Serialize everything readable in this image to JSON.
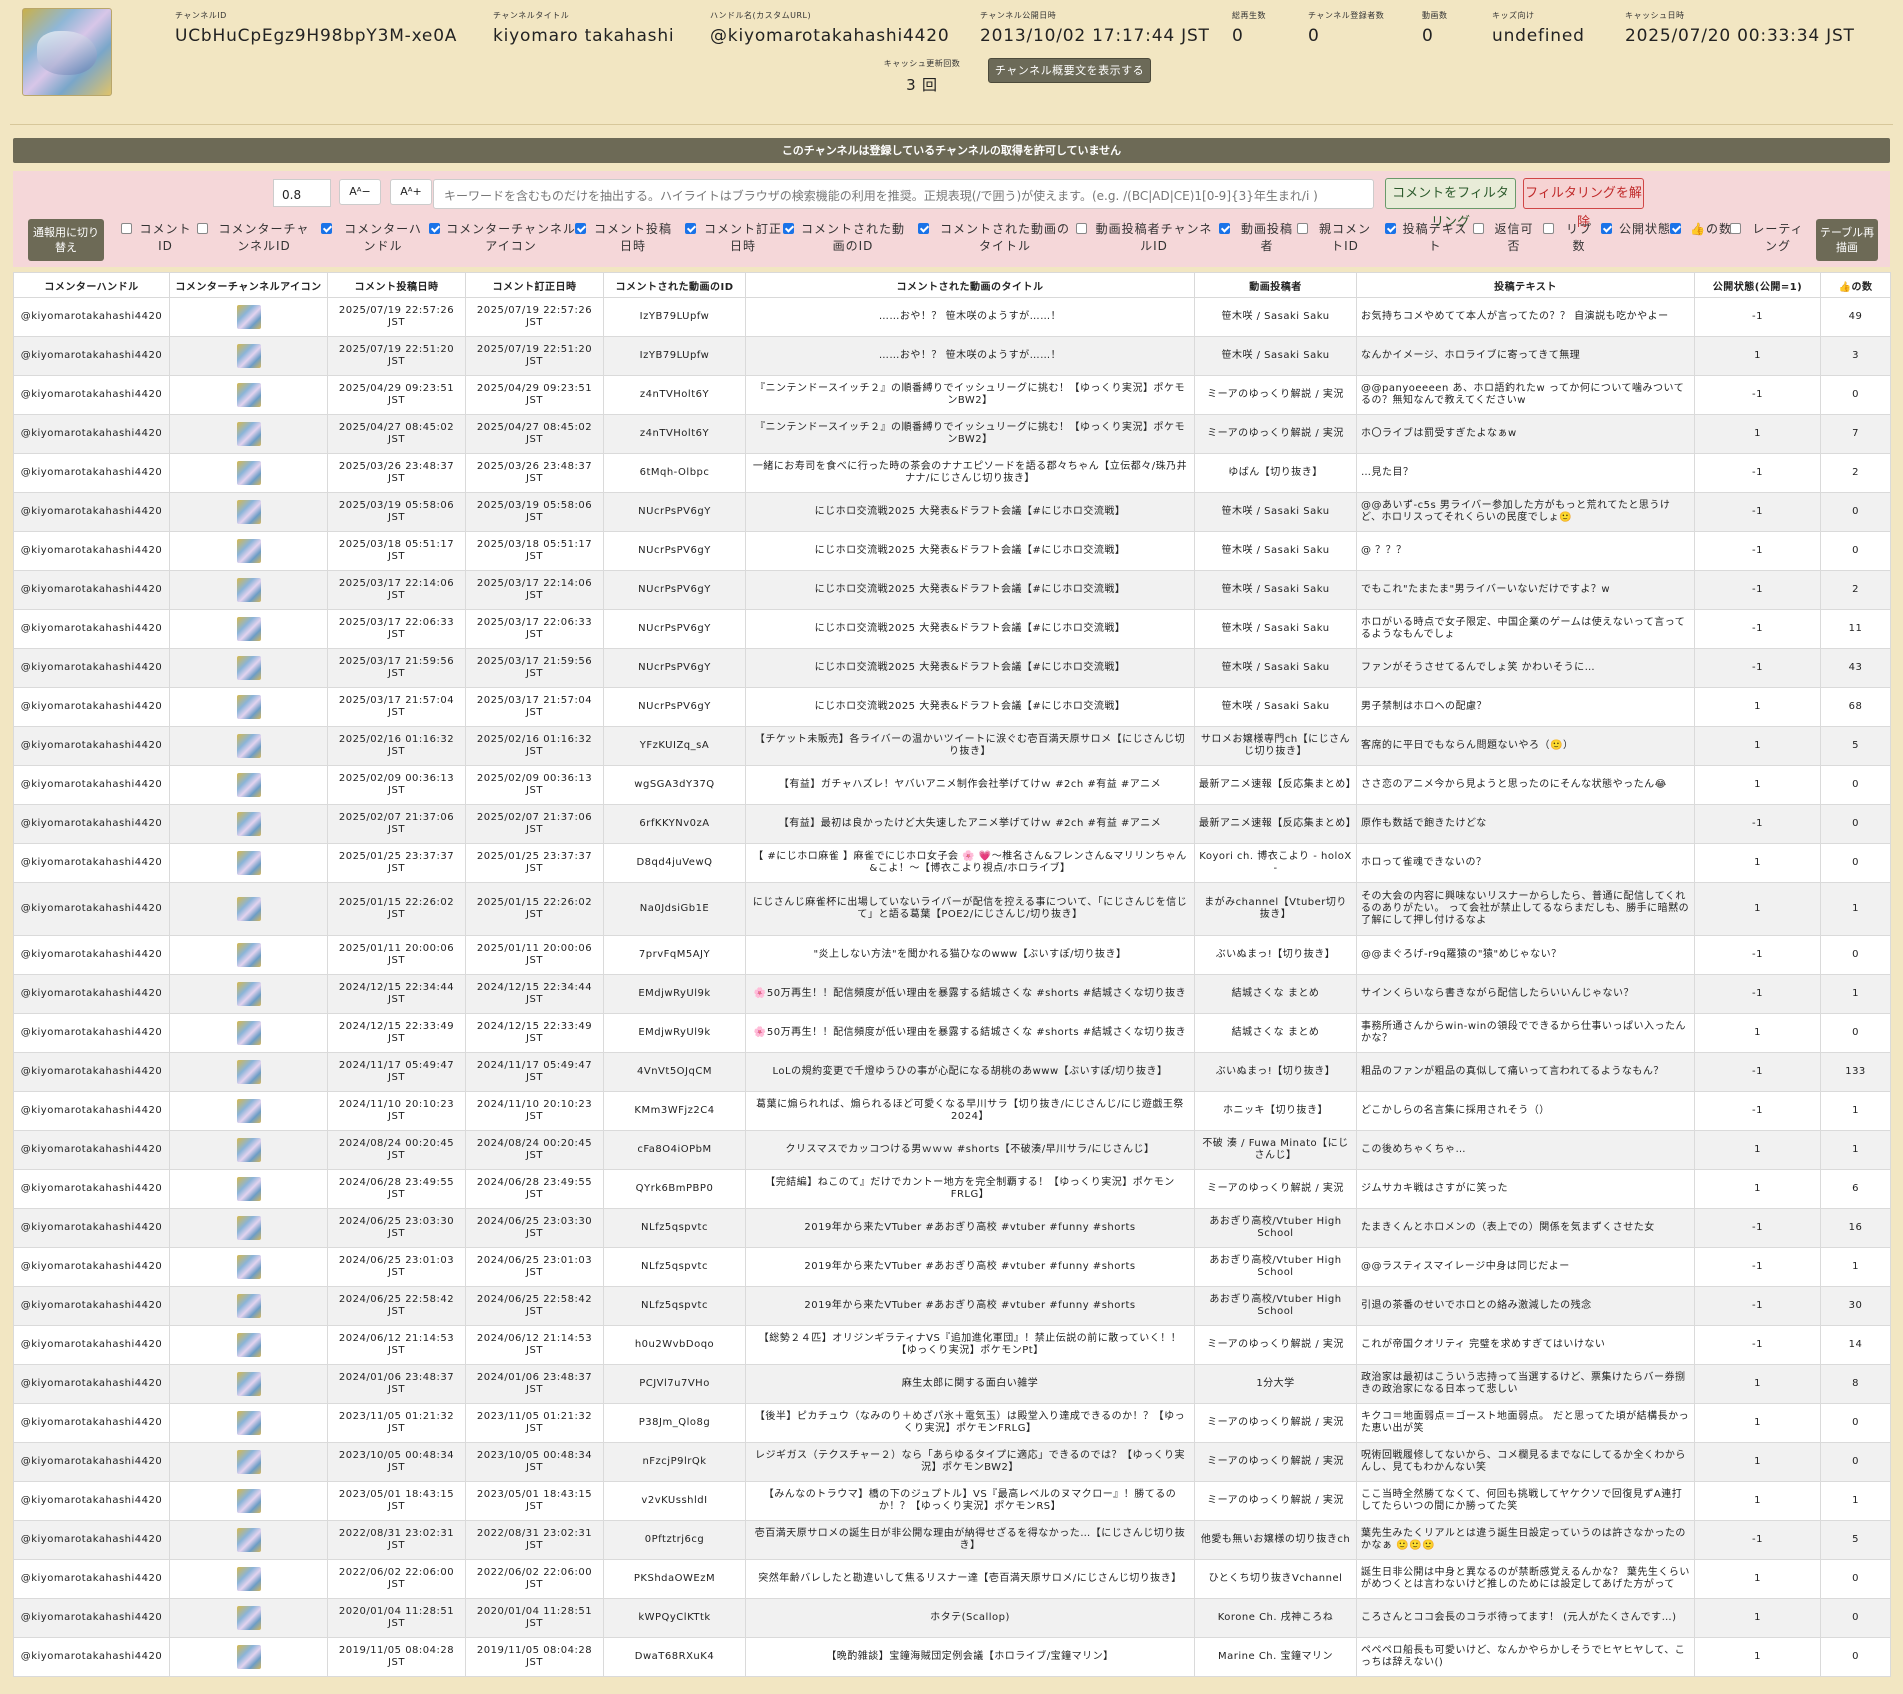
{
  "header": {
    "fields": [
      {
        "label": "チャンネルID",
        "value": "UCbHuCpEgz9H98bpY3M-xe0A"
      },
      {
        "label": "チャンネルタイトル",
        "value": "kiyomaro takahashi"
      },
      {
        "label": "ハンドル名(カスタムURL)",
        "value": "@kiyomarotakahashi4420"
      },
      {
        "label": "チャンネル公開日時",
        "value": "2013/10/02 17:17:44 JST"
      },
      {
        "label": "総再生数",
        "value": "0"
      },
      {
        "label": "チャンネル登録者数",
        "value": "0"
      },
      {
        "label": "動画数",
        "value": "0"
      },
      {
        "label": "キッズ向け",
        "value": "undefined"
      },
      {
        "label": "キャッシュ日時",
        "value": "2025/07/20 00:33:34 JST"
      }
    ],
    "cache_count": {
      "label": "キャッシュ更新回数",
      "value": "3 回"
    },
    "show_description_button": "チャンネル概要文を表示する"
  },
  "notice": "このチャンネルは登録しているチャンネルの取得を許可していません",
  "filter": {
    "zoom_value": "0.8",
    "font_smaller": "Aᴬ−",
    "font_larger": "Aᴬ+",
    "keyword_placeholder": "キーワードを含むものだけを抽出する。ハイライトはブラウザの検索機能の利用を推奨。正規表現(/で囲う)が使えます。(e.g. /(BC|AD|CE)1[0-9]{3}年生まれ/i )",
    "apply_button": "コメントをフィルタリング",
    "clear_button": "フィルタリングを解除",
    "toggle_button": "通報用に切り替え",
    "redraw_button": "テーブル再描画",
    "columns": [
      {
        "label": "コメントID",
        "checked": false
      },
      {
        "label": "コメンターチャンネルID",
        "checked": false
      },
      {
        "label": "コメンターハンドル",
        "checked": true
      },
      {
        "label": "コメンターチャンネルアイコン",
        "checked": true
      },
      {
        "label": "コメント投稿日時",
        "checked": true
      },
      {
        "label": "コメント訂正日時",
        "checked": true
      },
      {
        "label": "コメントされた動画のID",
        "checked": true
      },
      {
        "label": "コメントされた動画のタイトル",
        "checked": true
      },
      {
        "label": "動画投稿者チャンネルID",
        "checked": false
      },
      {
        "label": "動画投稿者",
        "checked": true
      },
      {
        "label": "親コメントID",
        "checked": false
      },
      {
        "label": "投稿テキスト",
        "checked": true
      },
      {
        "label": "返信可否",
        "checked": false
      },
      {
        "label": "リプ数",
        "checked": false
      },
      {
        "label": "公開状態",
        "checked": true
      },
      {
        "label": "👍の数",
        "checked": true
      },
      {
        "label": "レーティング",
        "checked": false
      }
    ]
  },
  "table": {
    "headers": [
      "コメンターハンドル",
      "コメンターチャンネルアイコン",
      "コメント投稿日時",
      "コメント訂正日時",
      "コメントされた動画のID",
      "コメントされた動画のタイトル",
      "動画投稿者",
      "投稿テキスト",
      "公開状態(公開=1)",
      "👍の数"
    ],
    "rows": [
      {
        "handle": "@kiyomarotakahashi4420",
        "posted": "2025/07/19 22:57:26 JST",
        "edited": "2025/07/19 22:57:26 JST",
        "vid": "IzYB79LUpfw",
        "title": "……おや！？ 笹木咲のようすが……！",
        "uploader": "笹木咲 / Sasaki Saku",
        "text": "お気持ちコメやめてて本人が言ってたの？？ 自演説も吃かやよー",
        "public": "-1",
        "likes": "49"
      },
      {
        "handle": "@kiyomarotakahashi4420",
        "posted": "2025/07/19 22:51:20 JST",
        "edited": "2025/07/19 22:51:20 JST",
        "vid": "IzYB79LUpfw",
        "title": "……おや！？ 笹木咲のようすが……！",
        "uploader": "笹木咲 / Sasaki Saku",
        "text": "なんかイメージ、ホロライブに寄ってきて無理",
        "public": "1",
        "likes": "3"
      },
      {
        "handle": "@kiyomarotakahashi4420",
        "posted": "2025/04/29 09:23:51 JST",
        "edited": "2025/04/29 09:23:51 JST",
        "vid": "z4nTVHolt6Y",
        "title": "『ニンテンドースイッチ２』の順番縛りでイッシュリーグに挑む！【ゆっくり実況】ポケモンBW2】",
        "uploader": "ミーアのゆっくり解説 / 実況",
        "text": "@@panyoeeeen あ、ホロ語釣れたw ってか何について噛みついてるの？無知なんで教えてくださいw",
        "public": "-1",
        "likes": "0"
      },
      {
        "handle": "@kiyomarotakahashi4420",
        "posted": "2025/04/27 08:45:02 JST",
        "edited": "2025/04/27 08:45:02 JST",
        "vid": "z4nTVHolt6Y",
        "title": "『ニンテンドースイッチ２』の順番縛りでイッシュリーグに挑む！【ゆっくり実況】ポケモンBW2】",
        "uploader": "ミーアのゆっくり解説 / 実況",
        "text": "ホ〇ライブは罰受すぎたよなぁw",
        "public": "1",
        "likes": "7"
      },
      {
        "handle": "@kiyomarotakahashi4420",
        "posted": "2025/03/26 23:48:37 JST",
        "edited": "2025/03/26 23:48:37 JST",
        "vid": "6tMqh-Olbpc",
        "title": "一緒にお寿司を食べに行った時の茶会のナナエピソードを語る郡々ちゃん【立伝都々/珠乃井ナナ/にじさんじ切り抜き】",
        "uploader": "ゆばん【切り抜き】",
        "text": "…見た目？",
        "public": "-1",
        "likes": "2"
      },
      {
        "handle": "@kiyomarotakahashi4420",
        "posted": "2025/03/19 05:58:06 JST",
        "edited": "2025/03/19 05:58:06 JST",
        "vid": "NUcrPsPV6gY",
        "title": "にじホロ交流戦2025 大発表&ドラフト会議【#にじホロ交流戦】",
        "uploader": "笹木咲 / Sasaki Saku",
        "text": "@@あいず-c5s 男ライバー参加した方がもっと荒れてたと思うけど、ホロリスってそれくらいの民度でしょ🙂",
        "public": "-1",
        "likes": "0"
      },
      {
        "handle": "@kiyomarotakahashi4420",
        "posted": "2025/03/18 05:51:17 JST",
        "edited": "2025/03/18 05:51:17 JST",
        "vid": "NUcrPsPV6gY",
        "title": "にじホロ交流戦2025 大発表&ドラフト会議【#にじホロ交流戦】",
        "uploader": "笹木咲 / Sasaki Saku",
        "text": "@ ？？？",
        "public": "-1",
        "likes": "0"
      },
      {
        "handle": "@kiyomarotakahashi4420",
        "posted": "2025/03/17 22:14:06 JST",
        "edited": "2025/03/17 22:14:06 JST",
        "vid": "NUcrPsPV6gY",
        "title": "にじホロ交流戦2025 大発表&ドラフト会議【#にじホロ交流戦】",
        "uploader": "笹木咲 / Sasaki Saku",
        "text": "でもこれ\"たまたま\"男ライバーいないだけですよ？w",
        "public": "-1",
        "likes": "2"
      },
      {
        "handle": "@kiyomarotakahashi4420",
        "posted": "2025/03/17 22:06:33 JST",
        "edited": "2025/03/17 22:06:33 JST",
        "vid": "NUcrPsPV6gY",
        "title": "にじホロ交流戦2025 大発表&ドラフト会議【#にじホロ交流戦】",
        "uploader": "笹木咲 / Sasaki Saku",
        "text": "ホロがいる時点で女子限定、中国企業のゲームは使えないって言ってるようなもんでしょ",
        "public": "-1",
        "likes": "11"
      },
      {
        "handle": "@kiyomarotakahashi4420",
        "posted": "2025/03/17 21:59:56 JST",
        "edited": "2025/03/17 21:59:56 JST",
        "vid": "NUcrPsPV6gY",
        "title": "にじホロ交流戦2025 大発表&ドラフト会議【#にじホロ交流戦】",
        "uploader": "笹木咲 / Sasaki Saku",
        "text": "ファンがそうさせてるんでしょ笑 かわいそうに…",
        "public": "-1",
        "likes": "43"
      },
      {
        "handle": "@kiyomarotakahashi4420",
        "posted": "2025/03/17 21:57:04 JST",
        "edited": "2025/03/17 21:57:04 JST",
        "vid": "NUcrPsPV6gY",
        "title": "にじホロ交流戦2025 大発表&ドラフト会議【#にじホロ交流戦】",
        "uploader": "笹木咲 / Sasaki Saku",
        "text": "男子禁制はホロへの配慮？",
        "public": "1",
        "likes": "68"
      },
      {
        "handle": "@kiyomarotakahashi4420",
        "posted": "2025/02/16 01:16:32 JST",
        "edited": "2025/02/16 01:16:32 JST",
        "vid": "YFzKUIZq_sA",
        "title": "【チケット未販売】各ライバーの温かいツイートに涙ぐむ壱百満天原サロメ【にじさんじ切り抜き】",
        "uploader": "サロメお嬢様専門ch【にじさんじ切り抜き】",
        "text": "客席的に平日でもならん問題ないやろ（🙂）",
        "public": "1",
        "likes": "5"
      },
      {
        "handle": "@kiyomarotakahashi4420",
        "posted": "2025/02/09 00:36:13 JST",
        "edited": "2025/02/09 00:36:13 JST",
        "vid": "wgSGA3dY37Q",
        "title": "【有益】ガチャハズレ！ヤバいアニメ制作会社挙げてけｗ #2ch #有益 #アニメ",
        "uploader": "最新アニメ速報【反応集まとめ】",
        "text": "ささ恋のアニメ今から見ようと思ったのにそんな状態やったん😂",
        "public": "1",
        "likes": "0"
      },
      {
        "handle": "@kiyomarotakahashi4420",
        "posted": "2025/02/07 21:37:06 JST",
        "edited": "2025/02/07 21:37:06 JST",
        "vid": "6rfKKYNv0zA",
        "title": "【有益】最初は良かったけど大失速したアニメ挙げてけｗ #2ch #有益 #アニメ",
        "uploader": "最新アニメ速報【反応集まとめ】",
        "text": "原作も数話で飽きたけどな",
        "public": "-1",
        "likes": "0"
      },
      {
        "handle": "@kiyomarotakahashi4420",
        "posted": "2025/01/25 23:37:37 JST",
        "edited": "2025/01/25 23:37:37 JST",
        "vid": "D8qd4juVewQ",
        "title": "【 #にじホロ麻雀 】麻雀でにじホロ女子会 🌸 💗〜椎名さん&フレンさん&マリリンちゃん&こよ！〜【博衣こより視点/ホロライブ】",
        "uploader": "Koyori ch. 博衣こより - holoX -",
        "text": "ホロって雀魂できないの？",
        "public": "1",
        "likes": "0"
      },
      {
        "handle": "@kiyomarotakahashi4420",
        "posted": "2025/01/15 22:26:02 JST",
        "edited": "2025/01/15 22:26:02 JST",
        "vid": "Na0JdsiGb1E",
        "title": "にじさんじ麻雀杯に出場していないライバーが配信を控える事について、「にじさんじを信じて」と語る葛葉【POE2/にじさんじ/切り抜き】",
        "uploader": "まがみchannel【Vtuber切り抜き】",
        "text": "その大会の内容に興味ないリスナーからしたら、普通に配信してくれるのありがたい。 って会社が禁止してるならまだしも、勝手に暗黙の了解にして押し付けるなよ",
        "public": "1",
        "likes": "1",
        "tall": true
      },
      {
        "handle": "@kiyomarotakahashi4420",
        "posted": "2025/01/11 20:00:06 JST",
        "edited": "2025/01/11 20:00:06 JST",
        "vid": "7prvFqM5AJY",
        "title": "\"炎上しない方法\"を聞かれる猫ひなのwww【ぶいすぽ/切り抜き】",
        "uploader": "ぶいぬまっ!【切り抜き】",
        "text": "@@まぐろげ-r9q羅猿の\"猿\"めじゃない？",
        "public": "-1",
        "likes": "0"
      },
      {
        "handle": "@kiyomarotakahashi4420",
        "posted": "2024/12/15 22:34:44 JST",
        "edited": "2024/12/15 22:34:44 JST",
        "vid": "EMdjwRyUl9k",
        "title": "🌸50万再生！！配信頻度が低い理由を暴露する結城さくな #shorts #結城さくな切り抜き",
        "uploader": "結城さくな まとめ",
        "text": "サインくらいなら書きながら配信したらいいんじゃない？",
        "public": "-1",
        "likes": "1"
      },
      {
        "handle": "@kiyomarotakahashi4420",
        "posted": "2024/12/15 22:33:49 JST",
        "edited": "2024/12/15 22:33:49 JST",
        "vid": "EMdjwRyUl9k",
        "title": "🌸50万再生！！配信頻度が低い理由を暴露する結城さくな #shorts #結城さくな切り抜き",
        "uploader": "結城さくな まとめ",
        "text": "事務所通さんからwin-winの領段でできるから仕事いっぱい入ったんかな？",
        "public": "1",
        "likes": "0"
      },
      {
        "handle": "@kiyomarotakahashi4420",
        "posted": "2024/11/17 05:49:47 JST",
        "edited": "2024/11/17 05:49:47 JST",
        "vid": "4VnVt5OJqCM",
        "title": "LoLの規約変更で千燈ゆうひの事が心配になる胡桃のあwww【ぶいすぽ/切り抜き】",
        "uploader": "ぶいぬまっ!【切り抜き】",
        "text": "粗品のファンが粗品の真似して痛いって言われてるようなもん？",
        "public": "-1",
        "likes": "133"
      },
      {
        "handle": "@kiyomarotakahashi4420",
        "posted": "2024/11/10 20:10:23 JST",
        "edited": "2024/11/10 20:10:23 JST",
        "vid": "KMm3WFjz2C4",
        "title": "葛葉に煽られれば、煽られるほど可愛くなる早川サラ【切り抜き/にじさんじ/にじ遊戯王祭2024】",
        "uploader": "ホニッキ【切り抜き】",
        "text": "どこかしらの名言集に採用されそう（）",
        "public": "-1",
        "likes": "1"
      },
      {
        "handle": "@kiyomarotakahashi4420",
        "posted": "2024/08/24 00:20:45 JST",
        "edited": "2024/08/24 00:20:45 JST",
        "vid": "cFa8O4iOPbM",
        "title": "クリスマスでカッコつける男ｗｗｗ #shorts【不破湊/早川サラ/にじさんじ】",
        "uploader": "不破 湊 / Fuwa Minato【にじさんじ】",
        "text": "この後めちゃくちゃ…",
        "public": "1",
        "likes": "1"
      },
      {
        "handle": "@kiyomarotakahashi4420",
        "posted": "2024/06/28 23:49:55 JST",
        "edited": "2024/06/28 23:49:55 JST",
        "vid": "QYrk6BmPBP0",
        "title": "【完結編】ねこのて』だけでカントー地方を完全制覇する！【ゆっくり実況】ポケモンFRLG】",
        "uploader": "ミーアのゆっくり解説 / 実況",
        "text": "ジムサカキ戦はさすがに笑った",
        "public": "1",
        "likes": "6"
      },
      {
        "handle": "@kiyomarotakahashi4420",
        "posted": "2024/06/25 23:03:30 JST",
        "edited": "2024/06/25 23:03:30 JST",
        "vid": "NLfz5qspvtc",
        "title": "2019年から来たVTuber #あおぎり高校 #vtuber #funny #shorts",
        "uploader": "あおぎり高校/Vtuber High School",
        "text": "たまきくんとホロメンの（表上での）関係を気まずくさせた女",
        "public": "-1",
        "likes": "16"
      },
      {
        "handle": "@kiyomarotakahashi4420",
        "posted": "2024/06/25 23:01:03 JST",
        "edited": "2024/06/25 23:01:03 JST",
        "vid": "NLfz5qspvtc",
        "title": "2019年から来たVTuber #あおぎり高校 #vtuber #funny #shorts",
        "uploader": "あおぎり高校/Vtuber High School",
        "text": "@@ラスティスマイレージ中身は同じだよー",
        "public": "-1",
        "likes": "1"
      },
      {
        "handle": "@kiyomarotakahashi4420",
        "posted": "2024/06/25 22:58:42 JST",
        "edited": "2024/06/25 22:58:42 JST",
        "vid": "NLfz5qspvtc",
        "title": "2019年から来たVTuber #あおぎり高校 #vtuber #funny #shorts",
        "uploader": "あおぎり高校/Vtuber High School",
        "text": "引退の茶番のせいでホロとの絡み激減したの残念",
        "public": "-1",
        "likes": "30"
      },
      {
        "handle": "@kiyomarotakahashi4420",
        "posted": "2024/06/12 21:14:53 JST",
        "edited": "2024/06/12 21:14:53 JST",
        "vid": "h0u2WvbDoqo",
        "title": "【総勢２４匹】オリジンギラティナVS『追加進化軍団』！禁止伝説の前に散っていく！！【ゆっくり実況】ポケモンPt】",
        "uploader": "ミーアのゆっくり解説 / 実況",
        "text": "これが帝国クオリティ 完璧を求めすぎてはいけない",
        "public": "-1",
        "likes": "14"
      },
      {
        "handle": "@kiyomarotakahashi4420",
        "posted": "2024/01/06 23:48:37 JST",
        "edited": "2024/01/06 23:48:37 JST",
        "vid": "PCJVl7u7VHo",
        "title": "麻生太郎に関する面白い雑学",
        "uploader": "1分大学",
        "text": "政治家は最初はこういう志持って当選するけど、票集けたらバー券捌きの政治家になる日本って悲しい",
        "public": "1",
        "likes": "8"
      },
      {
        "handle": "@kiyomarotakahashi4420",
        "posted": "2023/11/05 01:21:32 JST",
        "edited": "2023/11/05 01:21:32 JST",
        "vid": "P38Jm_Qlo8g",
        "title": "【後半】ピカチュウ（なみのり＋めざパ氷＋電気玉）は殿堂入り達成できるのか！？【ゆっくり実況】ポケモンFRLG】",
        "uploader": "ミーアのゆっくり解説 / 実況",
        "text": "キクコ＝地面弱点＝ゴースト地面弱点。 だと思ってた頃が結構長かった恵い出が笑",
        "public": "1",
        "likes": "0"
      },
      {
        "handle": "@kiyomarotakahashi4420",
        "posted": "2023/10/05 00:48:34 JST",
        "edited": "2023/10/05 00:48:34 JST",
        "vid": "nFzcjP9lrQk",
        "title": "レジギガス（テクスチャー２）なら「あらゆるタイプに適応」できるのでは？【ゆっくり実況】ポケモンBW2】",
        "uploader": "ミーアのゆっくり解説 / 実況",
        "text": "呪術回戦履修してないから、コメ欄見るまでなにしてるか全くわからんし、見てもわかんない笑",
        "public": "1",
        "likes": "0"
      },
      {
        "handle": "@kiyomarotakahashi4420",
        "posted": "2023/05/01 18:43:15 JST",
        "edited": "2023/05/01 18:43:15 JST",
        "vid": "v2vKUsshldI",
        "title": "【みんなのトラウマ】橋の下のジュプトル】VS『最高レベルのヌマクロー』！勝てるのか！？【ゆっくり実況】ポケモンRS】",
        "uploader": "ミーアのゆっくり解説 / 実況",
        "text": "ここ当時全然勝てなくて、何回も挑戦してヤケクソで回復見ずA連打してたらいつの間にか勝ってた笑",
        "public": "1",
        "likes": "1"
      },
      {
        "handle": "@kiyomarotakahashi4420",
        "posted": "2022/08/31 23:02:31 JST",
        "edited": "2022/08/31 23:02:31 JST",
        "vid": "0Pftztrj6cg",
        "title": "壱百満天原サロメの誕生日が非公開な理由が納得せざるを得なかった…【にじさんじ切り抜き】",
        "uploader": "他愛も無いお嬢様の切り抜きch",
        "text": "葉先生みたくリアルとは違う誕生日設定っていうのは許さなかったのかなぁ 🙂🙂🙂",
        "public": "-1",
        "likes": "5"
      },
      {
        "handle": "@kiyomarotakahashi4420",
        "posted": "2022/06/02 22:06:00 JST",
        "edited": "2022/06/02 22:06:00 JST",
        "vid": "PKShdaOWEzM",
        "title": "突然年齢バレしたと勘違いして焦るリスナー達【壱百満天原サロメ/にじさんじ切り抜き】",
        "uploader": "ひとくち切り抜きVchannel",
        "text": "誕生日非公開は中身と異なるのが禁断感覚えるんかな？ 葉先生くらいがめつくとは言わないけど推しのためには設定してあげた方がって",
        "public": "1",
        "likes": "0"
      },
      {
        "handle": "@kiyomarotakahashi4420",
        "posted": "2020/01/04 11:28:51 JST",
        "edited": "2020/01/04 11:28:51 JST",
        "vid": "kWPQyClKTtk",
        "title": "ホタテ(Scallop)",
        "uploader": "Korone Ch. 戌神ころね",
        "text": "ころさんとココ会長のコラボ待ってます！ (元人がたくさんです…)",
        "public": "1",
        "likes": "0"
      },
      {
        "handle": "@kiyomarotakahashi4420",
        "posted": "2019/11/05 08:04:28 JST",
        "edited": "2019/11/05 08:04:28 JST",
        "vid": "DwaT68RXuK4",
        "title": "【晩酌雑談】宝鐘海賊団定例会議【ホロライブ/宝鐘マリン】",
        "uploader": "Marine Ch. 宝鐘マリン",
        "text": "ペペペロ船長も可愛いけど、なんかやらかしそうでヒヤヒヤして、こっちは辞えない()",
        "public": "1",
        "likes": "0"
      }
    ]
  }
}
